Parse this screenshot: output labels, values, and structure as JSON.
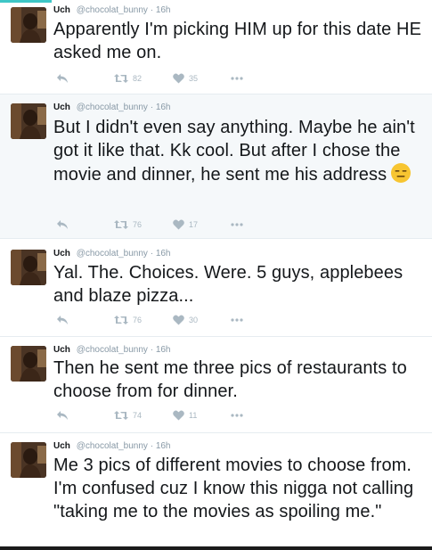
{
  "tweets": [
    {
      "name": "Uch",
      "handle": "@chocolat_bunny",
      "sep": "·",
      "time": "16h",
      "text": "Apparently I'm picking HIM up for this date HE asked me on.",
      "retweets": "82",
      "likes": "35"
    },
    {
      "name": "Uch",
      "handle": "@chocolat_bunny",
      "sep": "·",
      "time": "16h",
      "text": "But I didn't even say anything. Maybe he ain't got it like that. Kk cool. But after I chose the movie and dinner, he sent me his address",
      "emoji": "expressionless-face",
      "retweets": "76",
      "likes": "17"
    },
    {
      "name": "Uch",
      "handle": "@chocolat_bunny",
      "sep": "·",
      "time": "16h",
      "text": "Yal. The. Choices. Were. 5 guys, applebees and blaze pizza...",
      "retweets": "76",
      "likes": "30"
    },
    {
      "name": "Uch",
      "handle": "@chocolat_bunny",
      "sep": "·",
      "time": "16h",
      "text": "Then he sent me three pics of restaurants to choose from for dinner.",
      "retweets": "74",
      "likes": "11"
    },
    {
      "name": "Uch",
      "handle": "@chocolat_bunny",
      "sep": "·",
      "time": "16h",
      "text": "Me 3 pics of different movies to choose from. I'm confused cuz I know this nigga not calling \"taking me to the movies as spoiling me.\""
    }
  ],
  "icons": {
    "reply": "reply-icon",
    "retweet": "retweet-icon",
    "like": "heart-icon",
    "more": "more-icon"
  },
  "colors": {
    "accent": "#3ec6c6",
    "text": "#14171a",
    "muted": "#8899a6",
    "icon": "#aab8c2",
    "alt_bg": "#f5f8fa"
  }
}
